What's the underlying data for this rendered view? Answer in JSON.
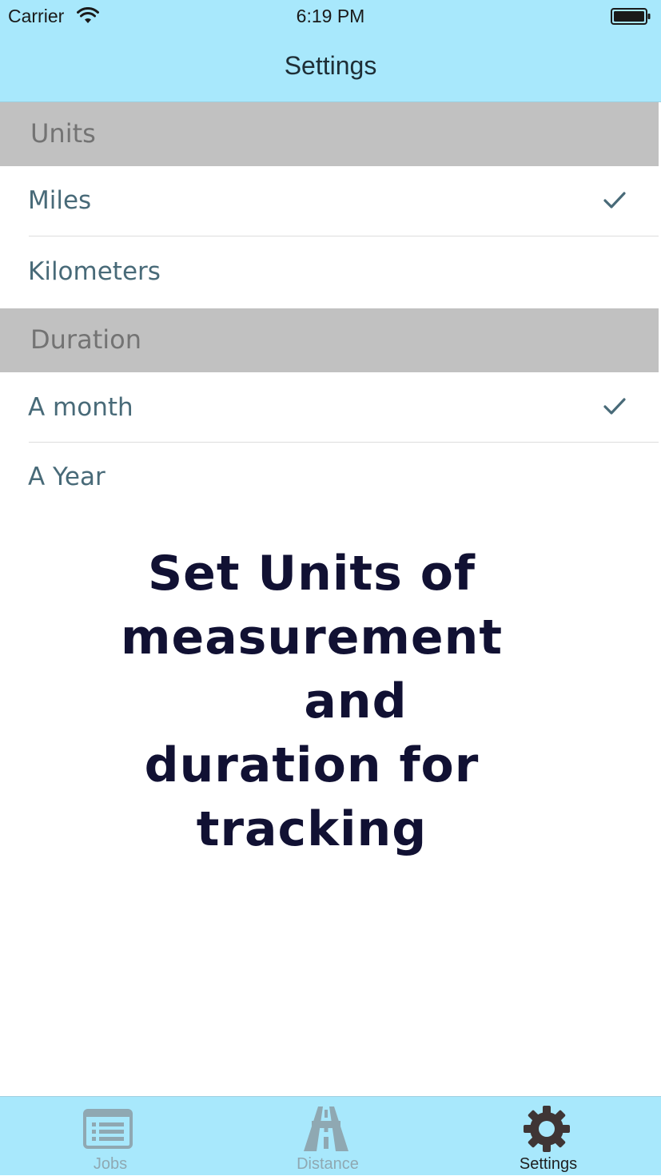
{
  "status_bar": {
    "carrier": "Carrier",
    "time": "6:19 PM",
    "wifi_icon": "wifi-icon",
    "battery_icon": "battery-icon"
  },
  "nav": {
    "title": "Settings"
  },
  "sections": [
    {
      "title": "Units",
      "rows": [
        {
          "label": "Miles",
          "checked": true
        },
        {
          "label": "Kilometers",
          "checked": false
        }
      ]
    },
    {
      "title": "Duration",
      "rows": [
        {
          "label": "A month",
          "checked": true
        },
        {
          "label": "A Year",
          "checked": false
        }
      ]
    }
  ],
  "overlay_note": {
    "lines": [
      "Set Units of",
      "measurement",
      "and",
      "duration for",
      "tracking"
    ]
  },
  "tabbar": {
    "items": [
      {
        "label": "Jobs",
        "icon": "list-icon",
        "active": false
      },
      {
        "label": "Distance",
        "icon": "road-icon",
        "active": false
      },
      {
        "label": "Settings",
        "icon": "gear-icon",
        "active": true
      }
    ]
  },
  "colors": {
    "bar_background": "#a8e8fc",
    "section_header": "#c1c1c1",
    "row_text": "#486a78",
    "tab_active": "#3a3a3a",
    "tab_inactive": "#8fa8b2"
  }
}
